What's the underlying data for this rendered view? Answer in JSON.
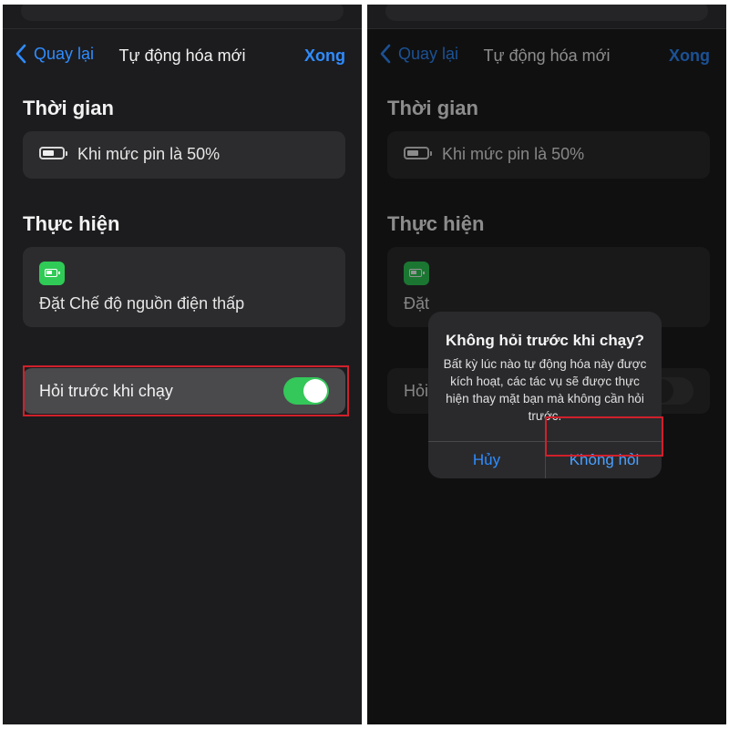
{
  "nav": {
    "back_label": "Quay lại",
    "title": "Tự động hóa mới",
    "done_label": "Xong"
  },
  "time_section": {
    "title": "Thời gian",
    "trigger_text": "Khi mức pin là 50%"
  },
  "action_section": {
    "title": "Thực hiện",
    "action_text": "Đặt Chế độ nguồn điện thấp"
  },
  "ask_setting": {
    "label": "Hỏi trước khi chạy",
    "left_on": true,
    "right_on": false,
    "right_label_partial": "Hỏi"
  },
  "right_action_partial": "Đặt",
  "alert": {
    "title": "Không hỏi trước khi chạy?",
    "message": "Bất kỳ lúc nào tự động hóa này được kích hoạt, các tác vụ sẽ được thực hiện thay mặt bạn mà không cần hỏi trước.",
    "cancel_label": "Hủy",
    "confirm_label": "Không hỏi"
  },
  "colors": {
    "accent": "#2f8cff",
    "toggle_on": "#34c759",
    "highlight": "#d0202b",
    "action_tile": "#2fcb56"
  },
  "icons": {
    "back": "chevron-left-icon",
    "trigger": "battery-icon",
    "action": "low-power-battery-icon"
  }
}
